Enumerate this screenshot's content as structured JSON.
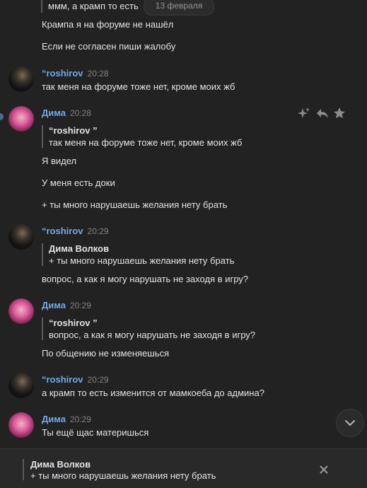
{
  "date_pill": "13 февраля",
  "messages": [
    {
      "text": "ммм, а крамп то есть"
    },
    {
      "text": "Крампа я на форуме не нашёл"
    },
    {
      "text": "Если не согласен пиши жалобу"
    }
  ],
  "m1": {
    "author": "“roshirov",
    "time": "20:28",
    "text": "так меня на форуме тоже нет, кроме моих жб"
  },
  "m2": {
    "author": "Дима",
    "time": "20:28",
    "quote_author": "“roshirov ”",
    "quote_text": "так меня на форуме тоже нет, кроме моих жб",
    "lines": [
      "Я видел",
      "У меня есть доки",
      "+ ты много нарушаешь желания нету брать"
    ]
  },
  "m3": {
    "author": "“roshirov",
    "time": "20:29",
    "quote_author": "Дима Волков",
    "quote_text": "+ ты много нарушаешь желания нету брать",
    "text": "вопрос, а как я могу нарушать не заходя в игру?"
  },
  "m4": {
    "author": "Дима",
    "time": "20:29",
    "quote_author": "“roshirov ”",
    "quote_text": "вопрос, а как я могу нарушать не заходя в игру?",
    "text": "По общению не изменяешься"
  },
  "m5": {
    "author": "“roshirov",
    "time": "20:29",
    "text": "а крамп то есть изменится от мамкоеба до админа?"
  },
  "m6": {
    "author": "Дима",
    "time": "20:29",
    "text": "Ты ещё щас материшься"
  },
  "reply_preview": {
    "author": "Дима Волков",
    "text": "+ ты много нарушаешь желания нету брать"
  },
  "colors": {
    "accent": "#71aaeb",
    "background": "#222222",
    "text": "#e1e3e6",
    "muted": "#828282"
  }
}
